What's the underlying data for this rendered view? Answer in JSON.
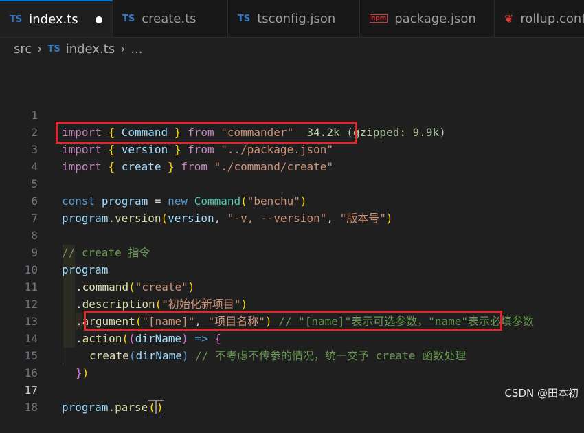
{
  "tabs": [
    {
      "label": "index.ts",
      "icon": "TS",
      "active": true,
      "modified": true
    },
    {
      "label": "create.ts",
      "icon": "TS"
    },
    {
      "label": "tsconfig.json",
      "icon": "TS"
    },
    {
      "label": "package.json",
      "icon": "npm"
    },
    {
      "label": "rollup.conf",
      "icon": "rollup"
    }
  ],
  "breadcrumb": {
    "folder": "src",
    "icon": "TS",
    "file": "index.ts",
    "more": "..."
  },
  "lines": [
    {
      "n": "1",
      "t": [
        "import",
        " ",
        "{",
        " ",
        "Command",
        " ",
        "}",
        " from ",
        "\"commander\"",
        "  ",
        "34.2k (gzipped: 9.9k)"
      ]
    },
    {
      "n": "2",
      "t": [
        "import",
        " ",
        "{",
        " ",
        "version",
        " ",
        "}",
        " from ",
        "\"../package.json\""
      ]
    },
    {
      "n": "3",
      "t": [
        "import",
        " ",
        "{",
        " ",
        "create",
        " ",
        "}",
        " from ",
        "\"./command/create\""
      ]
    },
    {
      "n": "4"
    },
    {
      "n": "5",
      "t": [
        "const",
        " ",
        "program",
        " = ",
        "new",
        " ",
        "Command",
        "(",
        "\"benchu\"",
        ")"
      ]
    },
    {
      "n": "6",
      "t": [
        "program",
        ".",
        "version",
        "(",
        "version",
        ", ",
        "\"-v, --version\"",
        ", ",
        "\"版本号\"",
        ")"
      ]
    },
    {
      "n": "7"
    },
    {
      "n": "8",
      "t": [
        "// create 指令"
      ]
    },
    {
      "n": "9",
      "t": [
        "program"
      ]
    },
    {
      "n": "10",
      "t": [
        ".",
        "command",
        "(",
        "\"create\"",
        ")"
      ]
    },
    {
      "n": "11",
      "t": [
        ".",
        "description",
        "(",
        "\"初始化新项目\"",
        ")"
      ]
    },
    {
      "n": "12",
      "t": [
        ".",
        "argument",
        "(",
        "\"[name]\"",
        ", ",
        "\"项目名称\"",
        ")",
        " ",
        "// \"[name]\"表示可选参数，\"name\"表示必填参数"
      ]
    },
    {
      "n": "13",
      "t": [
        ".",
        "action",
        "(",
        "(",
        "dirName",
        ")",
        " => ",
        "{"
      ]
    },
    {
      "n": "14",
      "t": [
        "create",
        "(",
        "dirName",
        ")",
        " ",
        "// 不考虑不传参的情况，统一交予 create 函数处理"
      ]
    },
    {
      "n": "15",
      "t": [
        "}",
        ")"
      ]
    },
    {
      "n": "16"
    },
    {
      "n": "17",
      "t": [
        "program",
        ".",
        "parse",
        "(",
        ")"
      ]
    },
    {
      "n": "18"
    }
  ],
  "watermark": "CSDN @田本初"
}
